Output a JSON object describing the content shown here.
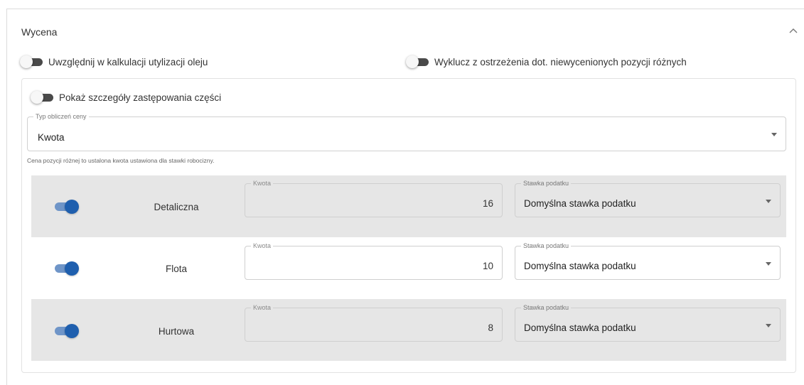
{
  "section": {
    "title": "Wycena",
    "collapse_icon": "chevron-up-icon"
  },
  "toggles": {
    "oil_utilization": {
      "label": "Uwzględnij w kalkulacji utylizacji oleju",
      "on": false
    },
    "exclude_warnings": {
      "label": "Wyklucz z ostrzeżenia dot. niewycenionych pozycji różnych",
      "on": false
    },
    "replacement_details": {
      "label": "Pokaż szczegóły zastępowania części",
      "on": false
    }
  },
  "price_calc": {
    "label": "Typ obliczeń ceny",
    "value": "Kwota",
    "helper": "Cena pozycji różnej to ustalona kwota ustawiona dla stawki robocizny."
  },
  "rates": [
    {
      "name": "Detaliczna",
      "enabled": true,
      "amount_label": "Kwota",
      "amount": "16",
      "amount_editable": false,
      "tax_label": "Stawka podatku",
      "tax_value": "Domyślna stawka podatku"
    },
    {
      "name": "Flota",
      "enabled": true,
      "amount_label": "Kwota",
      "amount": "10",
      "amount_editable": true,
      "tax_label": "Stawka podatku",
      "tax_value": "Domyślna stawka podatku"
    },
    {
      "name": "Hurtowa",
      "enabled": true,
      "amount_label": "Kwota",
      "amount": "8",
      "amount_editable": false,
      "tax_label": "Stawka podatku",
      "tax_value": "Domyślna stawka podatku"
    }
  ],
  "colors": {
    "switch_on_thumb": "#1f5fae",
    "switch_on_track": "#6f95c8",
    "switch_off_track": "#4a4a4a",
    "row_shade": "#e6e6e6"
  }
}
